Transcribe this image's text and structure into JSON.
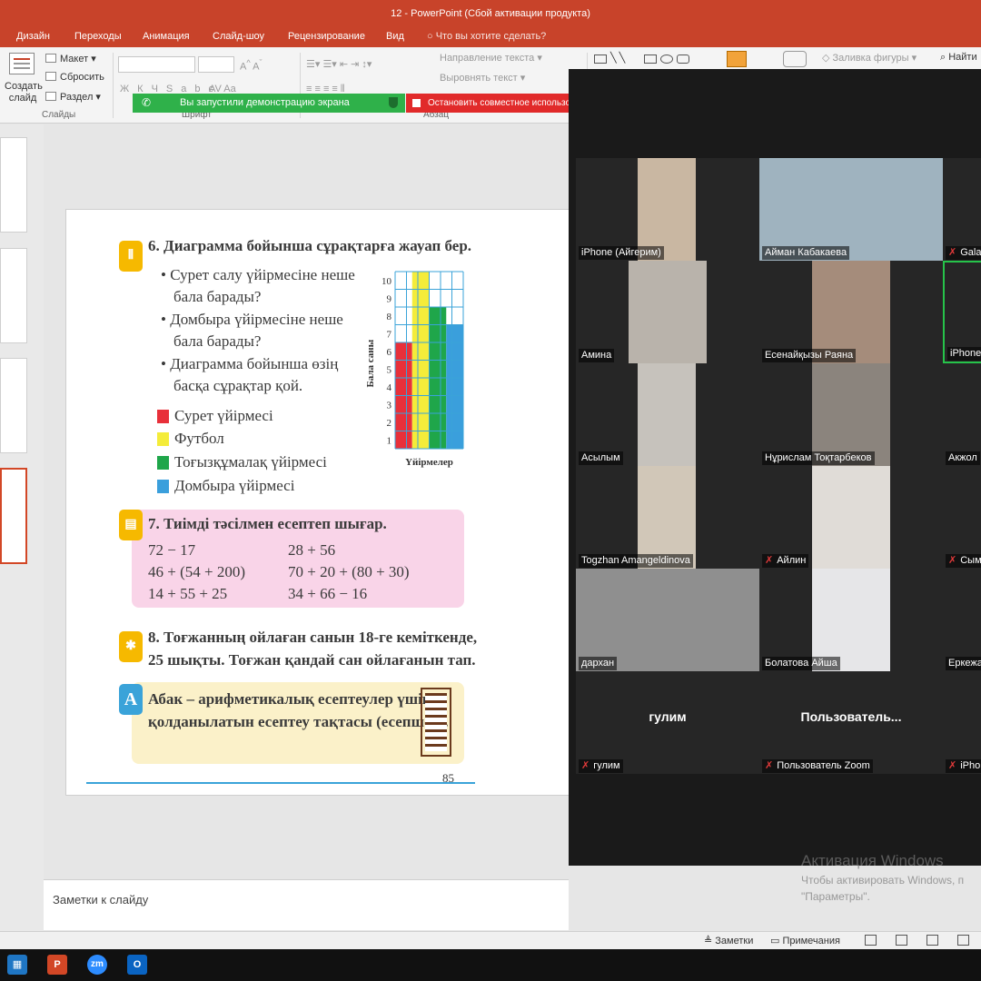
{
  "window": {
    "title": "12 - PowerPoint (Сбой активации продукта)"
  },
  "ribbon_tabs": [
    "Дизайн",
    "Переходы",
    "Анимация",
    "Слайд-шоу",
    "Рецензирование",
    "Вид"
  ],
  "tell_me": "Что вы хотите сделать?",
  "ribbon": {
    "new_slide": "Создать слайд",
    "layout": "Макет",
    "reset": "Сбросить",
    "section": "Раздел",
    "slides_group": "Слайды",
    "font_group": "Шрифт",
    "paragraph_group": "Абзац",
    "text_direction": "Направление текста",
    "align_text": "Выровнять текст",
    "shape_fill": "Заливка фигуры",
    "find": "Найти"
  },
  "banners": {
    "sharing": "Вы запустили демонстрацию экрана",
    "stop": "Остановить совместное использование"
  },
  "slide": {
    "q6": "6. Диаграмма бойынша сұрақтарға жауап бер.",
    "bullets": [
      [
        "Сурет салу үйірмесіне неше",
        "бала барады?"
      ],
      [
        "Домбыра үйірмесіне неше",
        "бала барады?"
      ],
      [
        "Диаграмма бойынша өзің",
        "басқа сұрақтар қой."
      ]
    ],
    "legend": [
      {
        "label": "Сурет үйірмесі",
        "color": "#e8303a"
      },
      {
        "label": "Футбол",
        "color": "#f4ec3a"
      },
      {
        "label": "Тоғызқұмалақ үйірмесі",
        "color": "#1fa64a"
      },
      {
        "label": "Домбыра үйірмесі",
        "color": "#3a9fdc"
      }
    ],
    "q7": "7. Тиімді тәсілмен есептеп шығар.",
    "exprs_left": [
      "72 − 17",
      "46 + (54 + 200)",
      "14 + 55 + 25"
    ],
    "exprs_right": [
      "28 + 56",
      "70 + 20 + (80 + 30)",
      "34 + 66 − 16"
    ],
    "q8_line1": "8. Тоғжанның ойлаған санын 18-ге кеміткенде,",
    "q8_line2": "25 шықты. Тоғжан қандай сан ойлағанын тап.",
    "a_badge": "A",
    "a_line1": "Абак – арифметикалық есептеулер үшін",
    "a_line2": "қолданылатын есептеу тақтасы (есепшот).",
    "page_number": "85"
  },
  "chart_data": {
    "type": "bar",
    "categories": [
      "Сурет үйірмесі",
      "Футбол",
      "Тоғызқұмалақ үйірмесі",
      "Домбыра үйірмесі"
    ],
    "values": [
      6,
      10,
      8,
      7
    ],
    "colors": [
      "#e8303a",
      "#f4ec3a",
      "#1fa64a",
      "#3a9fdc"
    ],
    "ylabel": "Бала саны",
    "xlabel": "Үйірмелер",
    "yticks": [
      1,
      2,
      3,
      4,
      5,
      6,
      7,
      8,
      9,
      10
    ],
    "ylim": [
      0,
      10
    ],
    "grid": true
  },
  "notes": {
    "placeholder": "Заметки к слайду"
  },
  "zoom": {
    "participants": [
      {
        "name": "iPhone (Айгерим)",
        "muted": false
      },
      {
        "name": "Айман Кабакаева",
        "muted": false
      },
      {
        "name": "Gala",
        "muted": true
      },
      {
        "name": "Амина",
        "muted": false
      },
      {
        "name": "Есенайқызы Раяна",
        "muted": false
      },
      {
        "name": "iPhone",
        "muted": false
      },
      {
        "name": "Асылым",
        "muted": false
      },
      {
        "name": "Нұрислам Тоқтарбеков",
        "muted": false
      },
      {
        "name": "Акжол",
        "muted": false
      },
      {
        "name": "Togzhan Amangeldinova",
        "muted": false
      },
      {
        "name": "Айлин",
        "muted": true
      },
      {
        "name": "Сым",
        "muted": true
      },
      {
        "name": "дархан",
        "muted": false
      },
      {
        "name": "Болатова Айша",
        "muted": false
      },
      {
        "name": "Еркежа",
        "muted": false
      },
      {
        "name": "гулим",
        "muted": true,
        "big": "гулим"
      },
      {
        "name": "Пользователь Zoom",
        "muted": true,
        "big": "Пользователь..."
      },
      {
        "name": "iPho",
        "muted": true
      }
    ]
  },
  "watermark": {
    "title": "Активация Windows",
    "line1": "Чтобы активировать Windows, п",
    "line2": "\"Параметры\"."
  },
  "statusbar": {
    "notes": "Заметки",
    "comments": "Примечания"
  },
  "taskbar": {
    "zoom": "zm",
    "powerpoint": "P",
    "outlook": "O"
  }
}
